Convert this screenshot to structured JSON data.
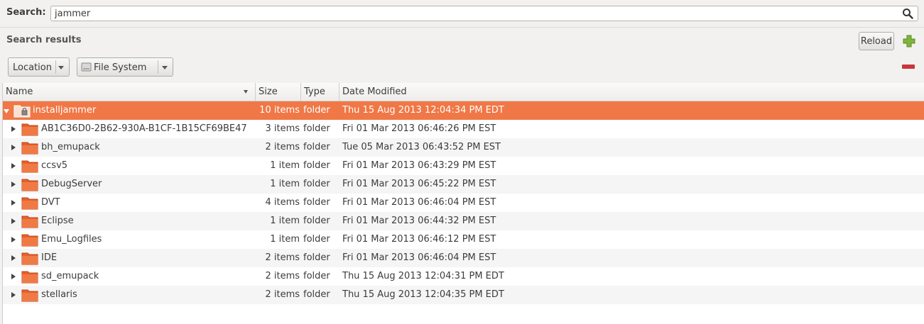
{
  "search": {
    "label": "Search:",
    "value": "jammer"
  },
  "results": {
    "title": "Search results",
    "reload_label": "Reload"
  },
  "filters": {
    "location_label": "Location",
    "filesystem_label": "File System"
  },
  "columns": {
    "name": "Name",
    "size": "Size",
    "type": "Type",
    "date": "Date Modified"
  },
  "rows": [
    {
      "name": "installjammer",
      "size": "10 items",
      "type": "folder",
      "date": "Thu 15 Aug 2013 12:04:34 PM EDT"
    },
    {
      "name": "AB1C36D0-2B62-930A-B1CF-1B15CF69BE47",
      "size": "3 items",
      "type": "folder",
      "date": "Fri 01 Mar 2013 06:46:26 PM EST"
    },
    {
      "name": "bh_emupack",
      "size": "2 items",
      "type": "folder",
      "date": "Tue 05 Mar 2013 06:43:52 PM EST"
    },
    {
      "name": "ccsv5",
      "size": "1 item",
      "type": "folder",
      "date": "Fri 01 Mar 2013 06:43:29 PM EST"
    },
    {
      "name": "DebugServer",
      "size": "1 item",
      "type": "folder",
      "date": "Fri 01 Mar 2013 06:45:22 PM EST"
    },
    {
      "name": "DVT",
      "size": "4 items",
      "type": "folder",
      "date": "Fri 01 Mar 2013 06:46:04 PM EST"
    },
    {
      "name": "Eclipse",
      "size": "1 item",
      "type": "folder",
      "date": "Fri 01 Mar 2013 06:44:32 PM EST"
    },
    {
      "name": "Emu_Logfiles",
      "size": "1 item",
      "type": "folder",
      "date": "Fri 01 Mar 2013 06:46:12 PM EST"
    },
    {
      "name": "IDE",
      "size": "2 items",
      "type": "folder",
      "date": "Fri 01 Mar 2013 06:46:04 PM EST"
    },
    {
      "name": "sd_emupack",
      "size": "2 items",
      "type": "folder",
      "date": "Thu 15 Aug 2013 12:04:31 PM EDT"
    },
    {
      "name": "stellaris",
      "size": "2 items",
      "type": "folder",
      "date": "Thu 15 Aug 2013 12:04:35 PM EDT"
    }
  ],
  "icons": {
    "search": "search-icon",
    "add": "add-icon",
    "remove": "remove-icon",
    "drive": "drive-icon",
    "folder": "folder-icon",
    "folder_locked": "locked-folder-icon"
  },
  "colors": {
    "selection": "#f07746",
    "folder": "#e8602c",
    "add": "#7fb53b",
    "remove": "#c8353a"
  }
}
